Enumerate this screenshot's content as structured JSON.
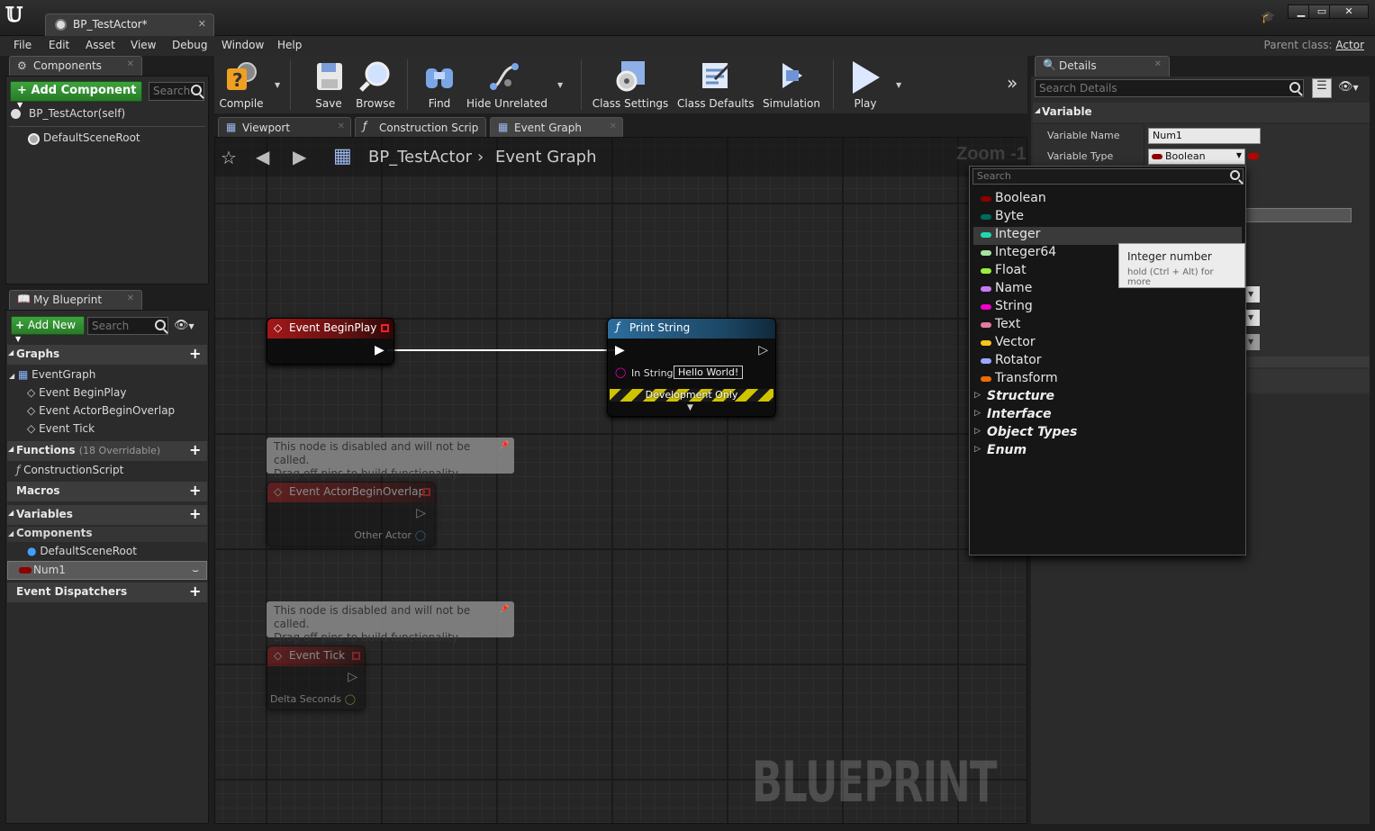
{
  "window": {
    "doc_tab": "BP_TestActor*",
    "buttons": [
      "▁",
      "▭",
      "✕"
    ]
  },
  "menu": {
    "items": [
      "File",
      "Edit",
      "Asset",
      "View",
      "Debug",
      "Window",
      "Help"
    ],
    "parent_class_label": "Parent class:",
    "parent_class_value": "Actor"
  },
  "components_panel": {
    "tab": "Components",
    "add_button": "Add Component",
    "search_placeholder": "Search",
    "items": [
      "BP_TestActor(self)",
      "DefaultSceneRoot"
    ]
  },
  "my_blueprint": {
    "tab": "My Blueprint",
    "add_new": "Add New",
    "search_placeholder": "Search",
    "graphs_header": "Graphs",
    "event_graph": "EventGraph",
    "events": [
      "Event BeginPlay",
      "Event ActorBeginOverlap",
      "Event Tick"
    ],
    "functions_header": "Functions",
    "functions_note": "(18 Overridable)",
    "construction_script": "ConstructionScript",
    "macros_header": "Macros",
    "variables_header": "Variables",
    "components_header": "Components",
    "default_scene_root": "DefaultSceneRoot",
    "selected_variable": "Num1",
    "dispatchers_header": "Event Dispatchers"
  },
  "toolbar": {
    "buttons": [
      "Compile",
      "Save",
      "Browse",
      "Find",
      "Hide Unrelated",
      "Class Settings",
      "Class Defaults",
      "Simulation",
      "Play"
    ]
  },
  "editor_tabs": [
    "Viewport",
    "Construction Scrip",
    "Event Graph"
  ],
  "graph": {
    "breadcrumb_root": "BP_TestActor",
    "breadcrumb_current": "Event Graph",
    "zoom": "Zoom -1",
    "watermark": "BLUEPRINT",
    "begin_play": "Event BeginPlay",
    "print_string": "Print String",
    "in_string_label": "In String",
    "in_string_value": "Hello World!",
    "dev_only": "Development Only",
    "disabled_comment_1": "This node is disabled and will not be called.",
    "disabled_comment_2": "Drag off pins to build functionality.",
    "overlap_node": "Event ActorBeginOverlap",
    "other_actor": "Other Actor",
    "tick_node": "Event Tick",
    "delta_seconds": "Delta Seconds"
  },
  "details": {
    "tab": "Details",
    "search_placeholder": "Search Details",
    "section": "Variable",
    "name_label": "Variable Name",
    "name_value": "Num1",
    "type_label": "Variable Type",
    "type_value": "Boolean"
  },
  "type_popup": {
    "search_placeholder": "Search",
    "types": [
      {
        "name": "Boolean",
        "color": "#8c0000"
      },
      {
        "name": "Byte",
        "color": "#006a5c"
      },
      {
        "name": "Integer",
        "color": "#1ed9b0"
      },
      {
        "name": "Integer64",
        "color": "#a8e3a0"
      },
      {
        "name": "Float",
        "color": "#9cf03c"
      },
      {
        "name": "Name",
        "color": "#c77bf2"
      },
      {
        "name": "String",
        "color": "#f000c8"
      },
      {
        "name": "Text",
        "color": "#e27ba1"
      },
      {
        "name": "Vector",
        "color": "#f5c61a"
      },
      {
        "name": "Rotator",
        "color": "#9ba8ff"
      },
      {
        "name": "Transform",
        "color": "#f06b00"
      }
    ],
    "categories": [
      "Structure",
      "Interface",
      "Object Types",
      "Enum"
    ],
    "tooltip_title": "Integer number",
    "tooltip_hint": "hold (Ctrl + Alt) for more"
  }
}
